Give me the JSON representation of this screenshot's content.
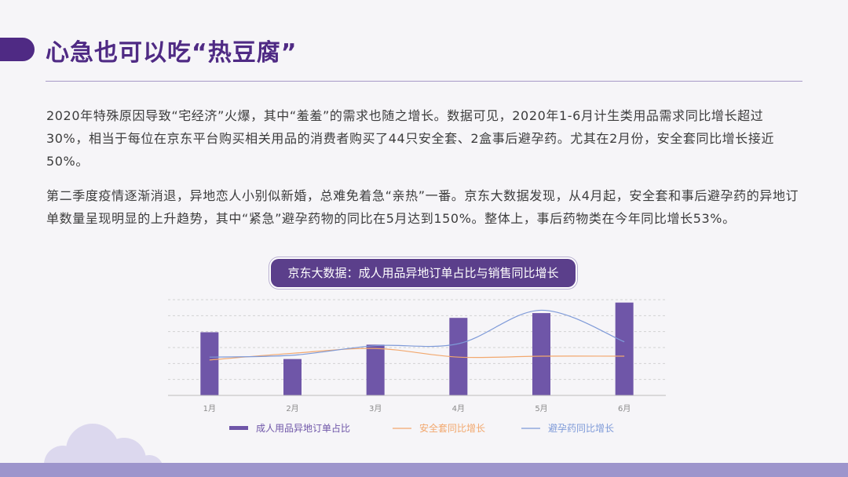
{
  "page": {
    "title": "心急也可以吃“热豆腐”",
    "paragraphs": [
      "2020年特殊原因导致“宅经济”火爆，其中“羞羞”的需求也随之增长。数据可见，2020年1-6月计生类用品需求同比增长超过30%，相当于每位在京东平台购买相关用品的消费者购买了44只安全套、2盒事后避孕药。尤其在2月份，安全套同比增长接近50%。",
      "第二季度疫情逐渐消退，异地恋人小别似新婚，总难免着急“亲热”一番。京东大数据发现，从4月起，安全套和事后避孕药的异地订单数量呈现明显的上升趋势，其中“紧急”避孕药物的同比在5月达到150%。整体上，事后药物类在今年同比增长53%。"
    ]
  },
  "colors": {
    "accent": "#4f2a84",
    "bar": "#6f56a8",
    "condom_line": "#f2a86e",
    "pill_line": "#7e9ad8",
    "band": "#9d95cc"
  },
  "chart_data": {
    "type": "bar",
    "title": "京东大数据：成人用品异地订单占比与销售同比增长",
    "categories": [
      "1月",
      "2月",
      "3月",
      "4月",
      "5月",
      "6月"
    ],
    "ylim": [
      0,
      100
    ],
    "grid": true,
    "legend": "bottom",
    "series": [
      {
        "name": "成人用品异地订单占比",
        "type": "bar",
        "values": [
          66,
          38,
          53,
          81,
          86,
          97
        ]
      },
      {
        "name": "安全套同比增长",
        "type": "line",
        "values": [
          37,
          44,
          49,
          40,
          41,
          41
        ]
      },
      {
        "name": "避孕药同比增长",
        "type": "line",
        "values": [
          40,
          42,
          52,
          54,
          89,
          56
        ]
      }
    ]
  }
}
